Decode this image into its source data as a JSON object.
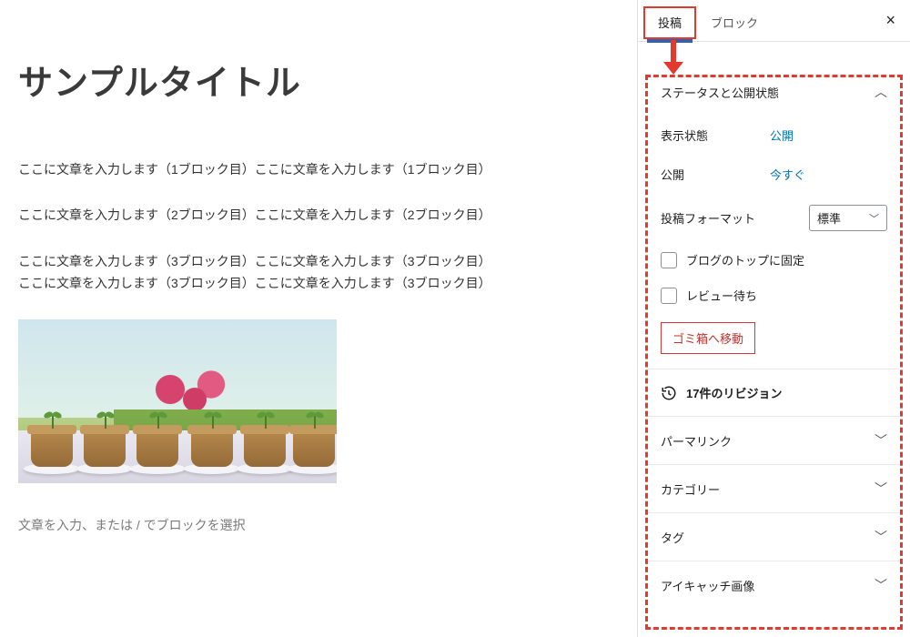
{
  "content": {
    "title": "サンプルタイトル",
    "blocks": [
      "ここに文章を入力します（1ブロック目）ここに文章を入力します（1ブロック目）",
      "ここに文章を入力します（2ブロック目）ここに文章を入力します（2ブロック目）",
      "ここに文章を入力します（3ブロック目）ここに文章を入力します（3ブロック目）",
      "ここに文章を入力します（3ブロック目）ここに文章を入力します（3ブロック目）"
    ],
    "placeholder": "文章を入力、または / でブロックを選択"
  },
  "sidebar": {
    "tabs": {
      "post": "投稿",
      "block": "ブロック"
    },
    "panels": {
      "status_title": "ステータスと公開状態",
      "visibility": {
        "label": "表示状態",
        "value": "公開"
      },
      "publish": {
        "label": "公開",
        "value": "今すぐ"
      },
      "format": {
        "label": "投稿フォーマット",
        "selected": "標準"
      },
      "stick_label": "ブログのトップに固定",
      "pending_label": "レビュー待ち",
      "trash": "ゴミ箱へ移動",
      "revisions": "17件のリビジョン",
      "permalink": "パーマリンク",
      "categories": "カテゴリー",
      "tags": "タグ",
      "featured": "アイキャッチ画像"
    }
  }
}
